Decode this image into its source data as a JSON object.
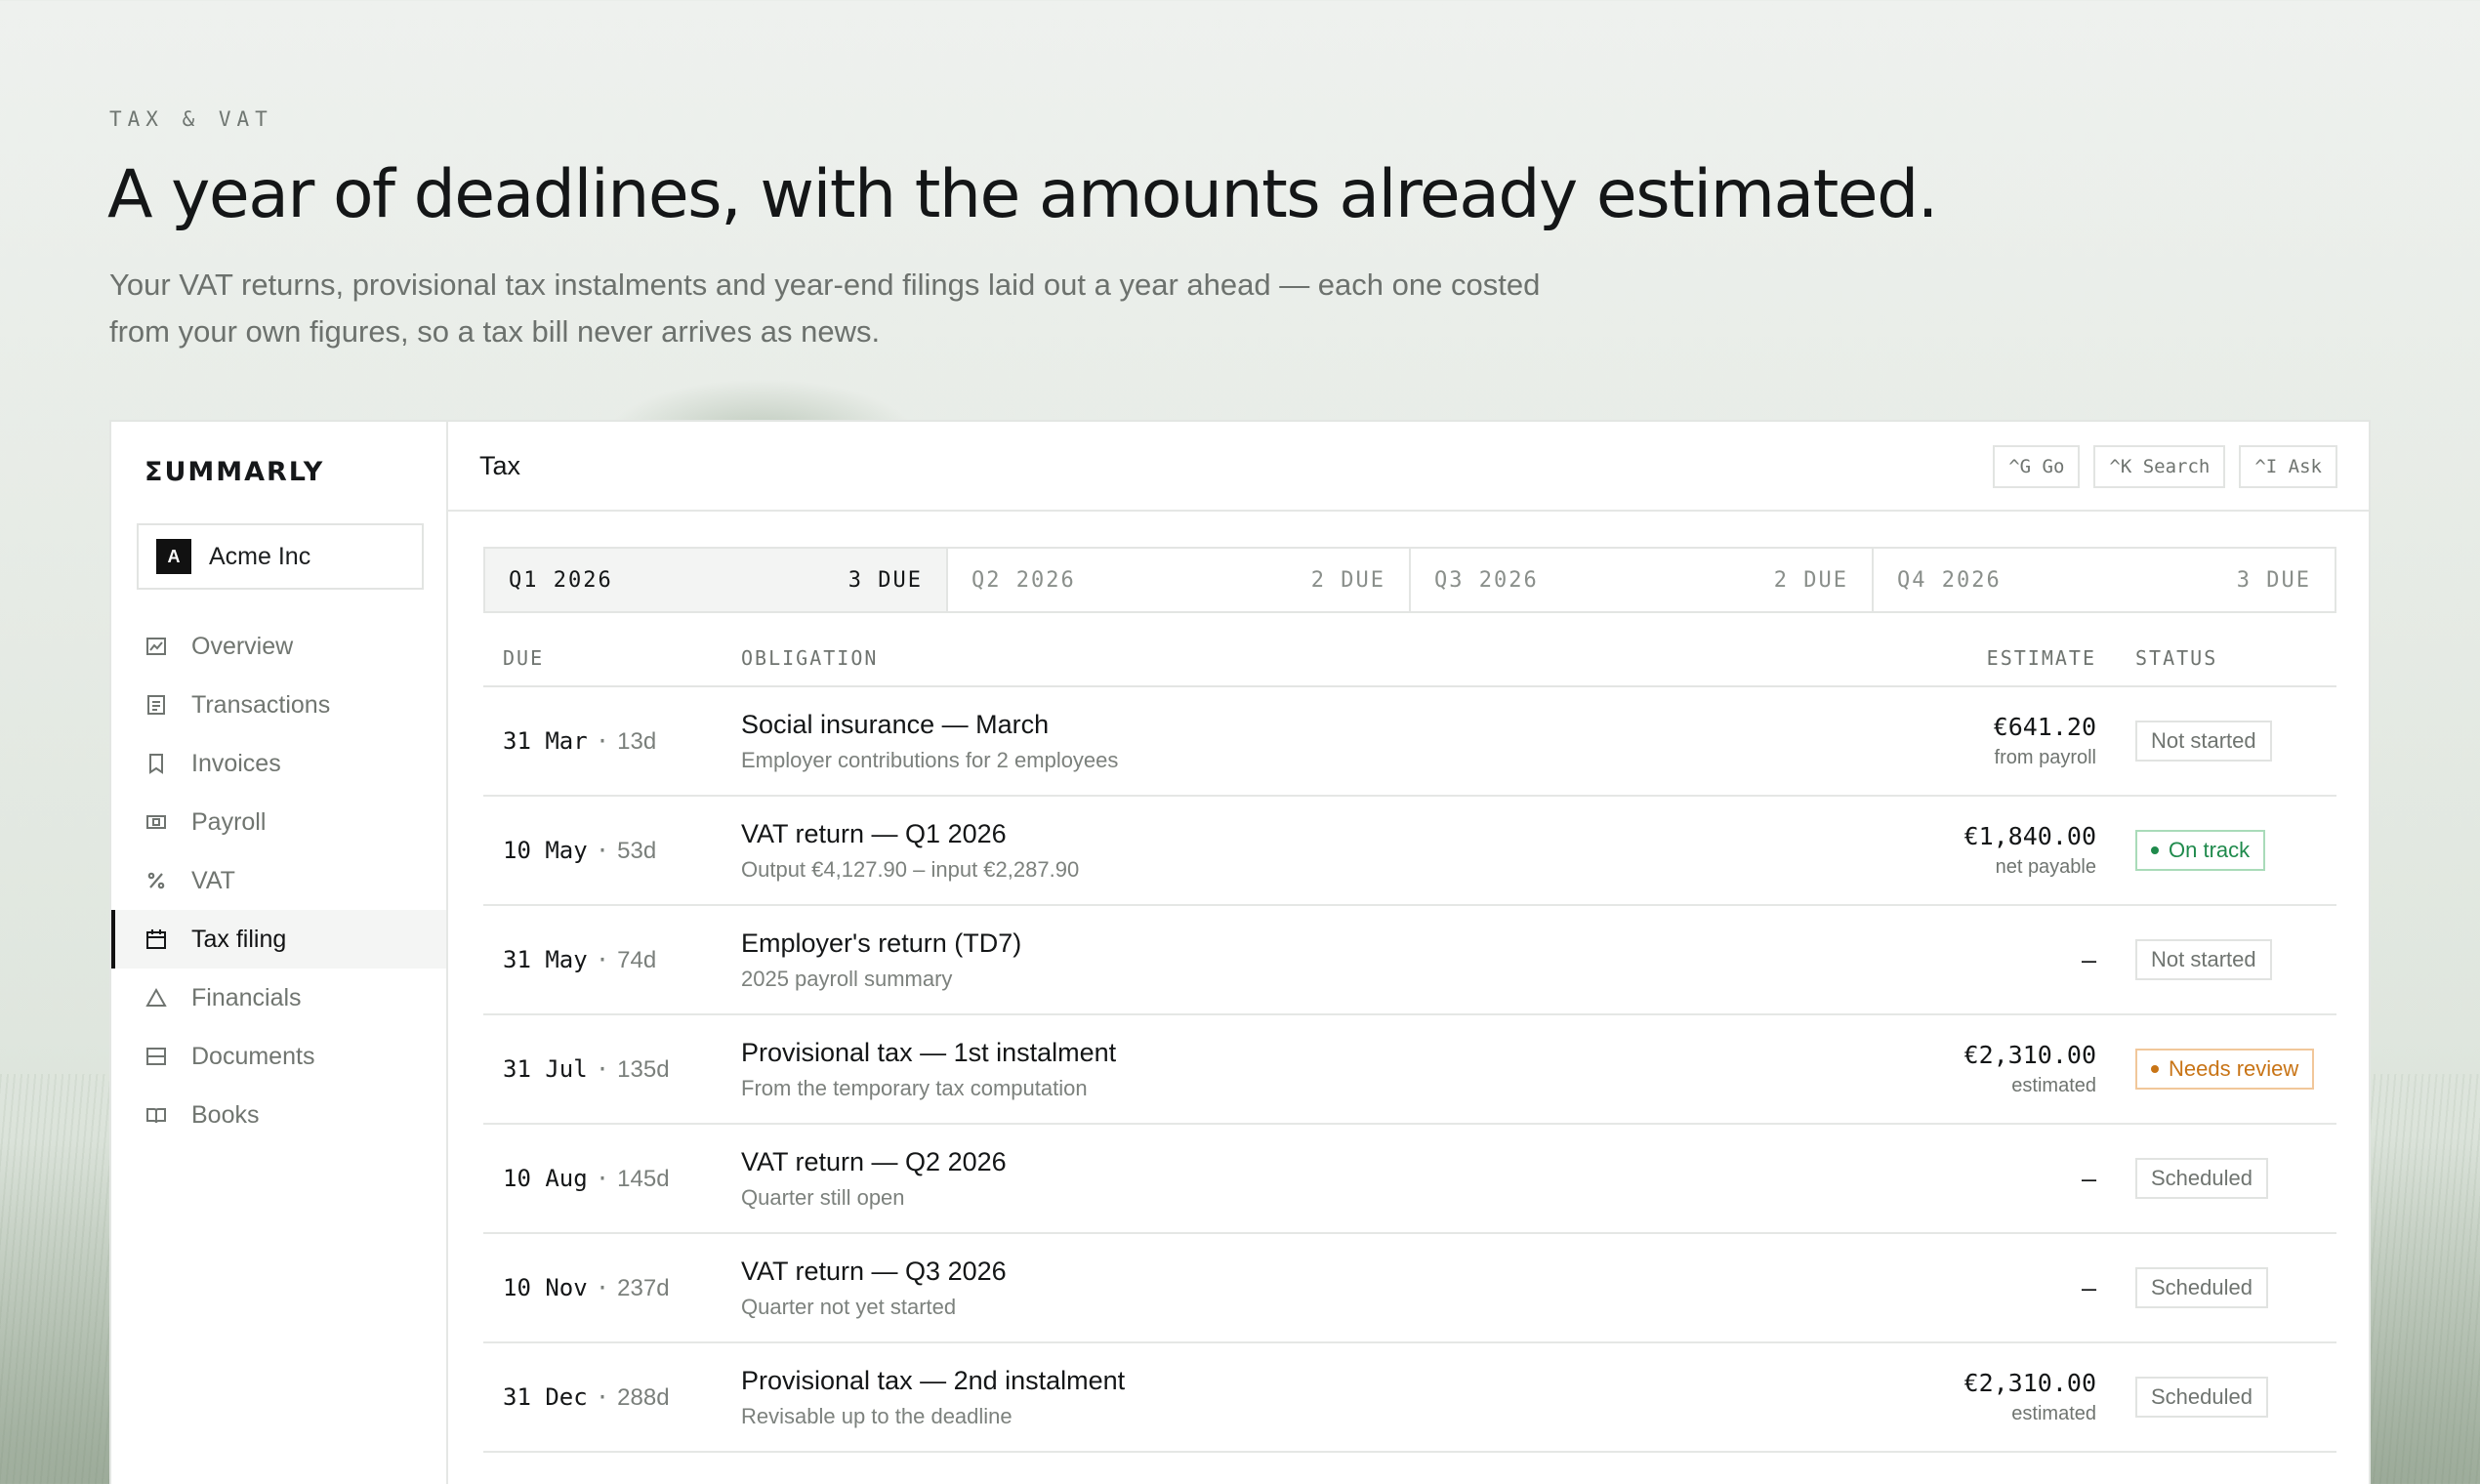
{
  "hero": {
    "eyebrow": "TAX & VAT",
    "headline": "A year of deadlines, with the amounts already estimated.",
    "subhead_line1": "Your VAT returns, provisional tax instalments and year-end filings laid out a year ahead — each one costed",
    "subhead_line2": "from your own figures, so a tax bill never arrives as news."
  },
  "sidebar": {
    "logo": "ΣUMMARLY",
    "org": {
      "badge": "A",
      "name": "Acme Inc"
    },
    "items": [
      {
        "label": "Overview",
        "icon": "chart-icon"
      },
      {
        "label": "Transactions",
        "icon": "list-icon"
      },
      {
        "label": "Invoices",
        "icon": "bookmark-icon"
      },
      {
        "label": "Payroll",
        "icon": "banknote-icon"
      },
      {
        "label": "VAT",
        "icon": "percent-icon"
      },
      {
        "label": "Tax filing",
        "icon": "calendar-icon",
        "active": true
      },
      {
        "label": "Financials",
        "icon": "triangle-icon"
      },
      {
        "label": "Documents",
        "icon": "drawer-icon"
      },
      {
        "label": "Books",
        "icon": "book-icon"
      }
    ]
  },
  "topbar": {
    "title": "Tax",
    "shortcuts": [
      "^G Go",
      "^K Search",
      "^I Ask"
    ]
  },
  "quarters": [
    {
      "label": "Q1 2026",
      "due": "3 DUE",
      "active": true
    },
    {
      "label": "Q2 2026",
      "due": "2 DUE"
    },
    {
      "label": "Q3 2026",
      "due": "2 DUE"
    },
    {
      "label": "Q4 2026",
      "due": "3 DUE"
    }
  ],
  "table": {
    "headers": {
      "due": "DUE",
      "obligation": "OBLIGATION",
      "estimate": "ESTIMATE",
      "status": "STATUS"
    },
    "rows": [
      {
        "date": "31 Mar",
        "days": "13d",
        "title": "Social insurance — March",
        "sub": "Employer contributions for 2 employees",
        "amount": "€641.20",
        "note": "from payroll",
        "status": "Not started",
        "tone": "neutral"
      },
      {
        "date": "10 May",
        "days": "53d",
        "title": "VAT return — Q1 2026",
        "sub": "Output €4,127.90 – input €2,287.90",
        "amount": "€1,840.00",
        "note": "net payable",
        "status": "On track",
        "tone": "ok"
      },
      {
        "date": "31 May",
        "days": "74d",
        "title": "Employer's return (TD7)",
        "sub": "2025 payroll summary",
        "amount": "—",
        "note": "",
        "status": "Not started",
        "tone": "neutral"
      },
      {
        "date": "31 Jul",
        "days": "135d",
        "title": "Provisional tax — 1st instalment",
        "sub": "From the temporary tax computation",
        "amount": "€2,310.00",
        "note": "estimated",
        "status": "Needs review",
        "tone": "warn"
      },
      {
        "date": "10 Aug",
        "days": "145d",
        "title": "VAT return — Q2 2026",
        "sub": "Quarter still open",
        "amount": "—",
        "note": "",
        "status": "Scheduled",
        "tone": "neutral"
      },
      {
        "date": "10 Nov",
        "days": "237d",
        "title": "VAT return — Q3 2026",
        "sub": "Quarter not yet started",
        "amount": "—",
        "note": "",
        "status": "Scheduled",
        "tone": "neutral"
      },
      {
        "date": "31 Dec",
        "days": "288d",
        "title": "Provisional tax — 2nd instalment",
        "sub": "Revisable up to the deadline",
        "amount": "€2,310.00",
        "note": "estimated",
        "status": "Scheduled",
        "tone": "neutral"
      }
    ]
  }
}
